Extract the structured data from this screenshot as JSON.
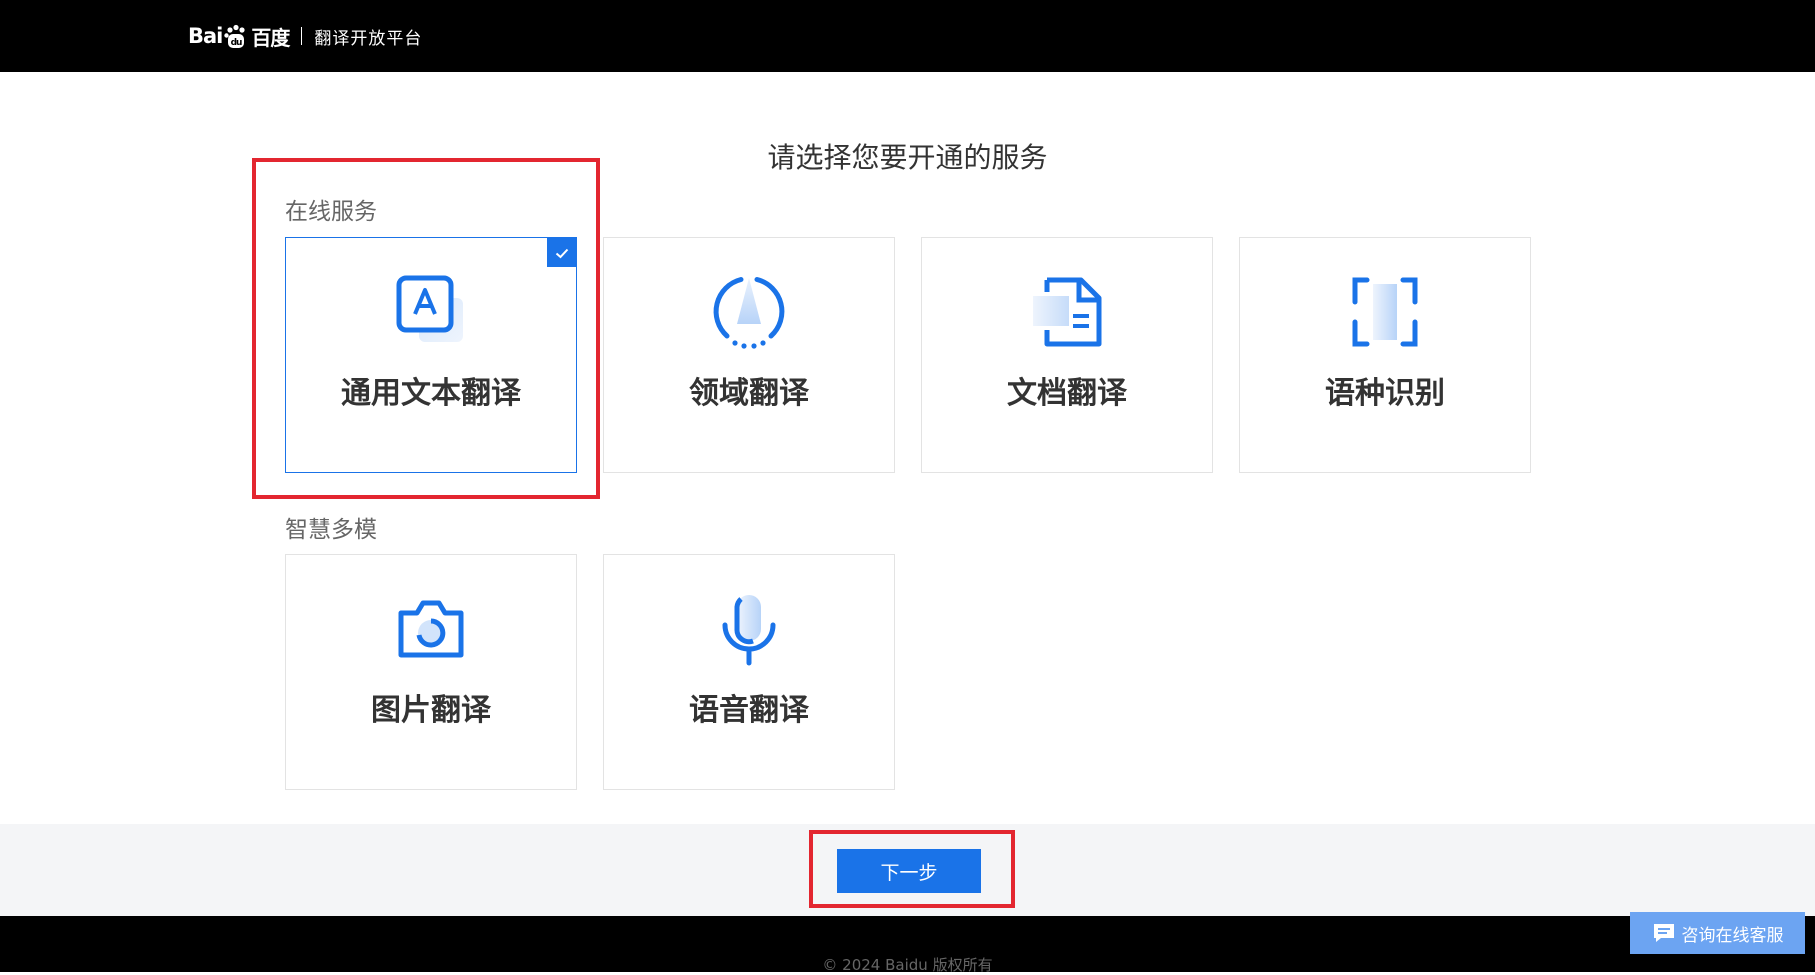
{
  "header": {
    "logo_text_en": "Bai",
    "logo_text_du": "du",
    "logo_text_cn": "百度",
    "platform_name": "翻译开放平台"
  },
  "page": {
    "title": "请选择您要开通的服务"
  },
  "sections": [
    {
      "label": "在线服务",
      "cards": [
        {
          "label": "通用文本翻译",
          "icon": "text-translate-icon",
          "selected": true
        },
        {
          "label": "领域翻译",
          "icon": "domain-translate-icon",
          "selected": false
        },
        {
          "label": "文档翻译",
          "icon": "document-translate-icon",
          "selected": false
        },
        {
          "label": "语种识别",
          "icon": "language-detect-icon",
          "selected": false
        }
      ]
    },
    {
      "label": "智慧多模",
      "cards": [
        {
          "label": "图片翻译",
          "icon": "camera-icon",
          "selected": false
        },
        {
          "label": "语音翻译",
          "icon": "microphone-icon",
          "selected": false
        }
      ]
    }
  ],
  "actions": {
    "next_label": "下一步"
  },
  "footer": {
    "copyright": "© 2024 Baidu 版权所有"
  },
  "chat": {
    "label": "咨询在线客服"
  },
  "colors": {
    "accent": "#1a73e8",
    "highlight": "#e32630",
    "header_bg": "#000000",
    "chat_bg": "#6ca4f2"
  }
}
